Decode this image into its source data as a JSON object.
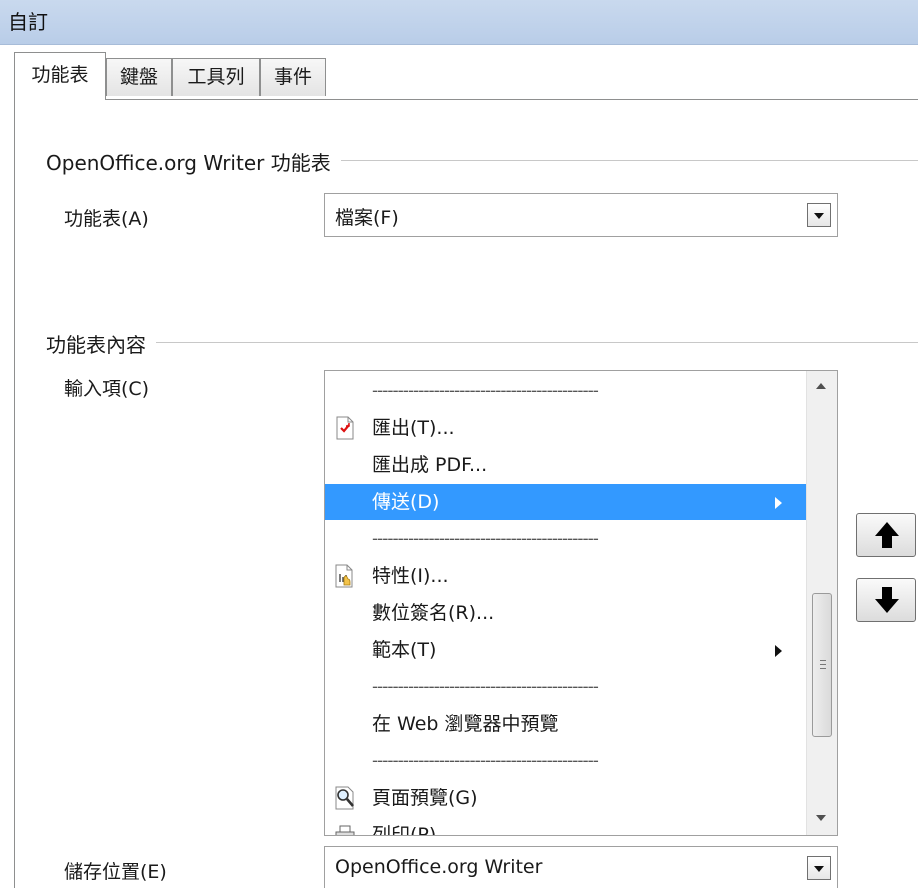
{
  "window": {
    "title": "自訂"
  },
  "tabs": [
    {
      "label": "功能表",
      "active": true
    },
    {
      "label": "鍵盤",
      "active": false
    },
    {
      "label": "工具列",
      "active": false
    },
    {
      "label": "事件",
      "active": false
    }
  ],
  "menu_group": {
    "title": "OpenOffice.org Writer 功能表",
    "menu_label": "功能表(A)",
    "menu_value": "檔案(F)"
  },
  "content_group": {
    "title": "功能表內容",
    "entries_label": "輸入項(C)",
    "entries": [
      {
        "text": "--------------------------------------------",
        "type": "separator"
      },
      {
        "text": "匯出(T)...",
        "icon": "export-icon"
      },
      {
        "text": "匯出成 PDF..."
      },
      {
        "text": "傳送(D)",
        "selected": true,
        "submenu": true
      },
      {
        "text": "--------------------------------------------",
        "type": "separator"
      },
      {
        "text": "特性(I)...",
        "icon": "properties-icon"
      },
      {
        "text": "數位簽名(R)..."
      },
      {
        "text": "範本(T)",
        "submenu": true
      },
      {
        "text": "--------------------------------------------",
        "type": "separator"
      },
      {
        "text": "在 Web 瀏覽器中預覽"
      },
      {
        "text": "--------------------------------------------",
        "type": "separator"
      },
      {
        "text": "頁面預覽(G)",
        "icon": "page-preview-icon"
      },
      {
        "text": "列印(P)...",
        "icon": "print-icon"
      }
    ],
    "save_label": "儲存位置(E)",
    "save_value": "OpenOffice.org Writer"
  },
  "colors": {
    "selection": "#3399ff",
    "titlebar": "#c9d9ee"
  }
}
